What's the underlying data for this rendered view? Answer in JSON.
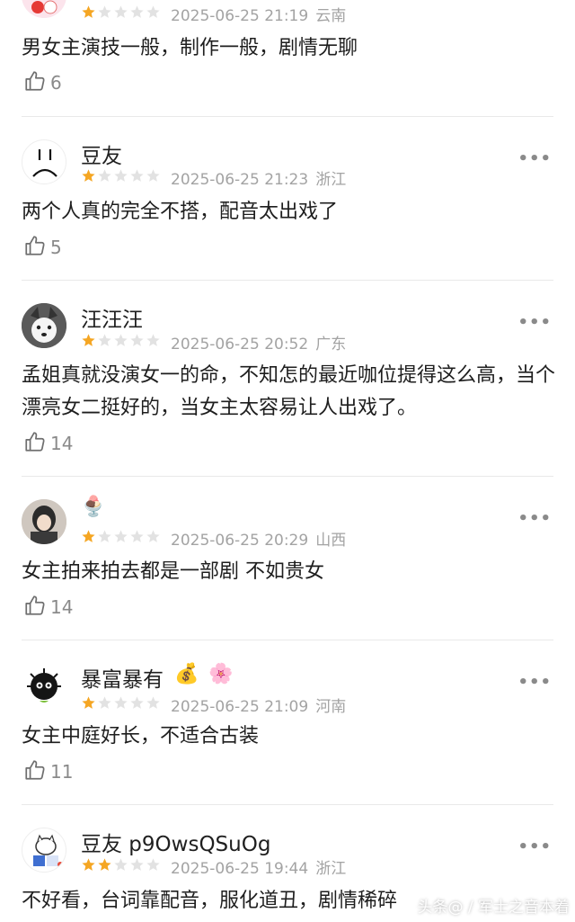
{
  "reviews": [
    {
      "username": "",
      "stars": 1,
      "date": "2025-06-25 21:19",
      "location": "云南",
      "content": "男女主演技一般，制作一般，剧情无聊",
      "likes": "6"
    },
    {
      "username": "豆友",
      "stars": 1,
      "date": "2025-06-25 21:23",
      "location": "浙江",
      "content": "两个人真的完全不搭，配音太出戏了",
      "likes": "5"
    },
    {
      "username": "汪汪汪",
      "stars": 1,
      "date": "2025-06-25 20:52",
      "location": "广东",
      "content": "孟姐真就没演女一的命，不知怎的最近咖位提得这么高，当个漂亮女二挺好的，当女主太容易让人出戏了。",
      "likes": "14"
    },
    {
      "username": "",
      "stars": 1,
      "date": "2025-06-25 20:29",
      "location": "山西",
      "content": "女主拍来拍去都是一部剧 不如贵女",
      "likes": "14"
    },
    {
      "username": "暴富暴有",
      "stars": 1,
      "date": "2025-06-25 21:09",
      "location": "河南",
      "content": "女主中庭好长，不适合古装",
      "likes": "11"
    },
    {
      "username": "豆友 p9OwsQSuOg",
      "stars": 2,
      "date": "2025-06-25 19:44",
      "location": "浙江",
      "content": "不好看，台词靠配音，服化道丑，剧情稀碎",
      "likes": ""
    }
  ],
  "icons": {
    "more": "more-dots-icon",
    "like": "thumbs-up-icon",
    "star": "star-icon"
  },
  "colors": {
    "star_filled": "#f5a623",
    "star_empty": "#e2e2e2",
    "meta_text": "#a3a3a3"
  },
  "more_label": "•••",
  "watermark": "头条@ / 军士之音本着"
}
